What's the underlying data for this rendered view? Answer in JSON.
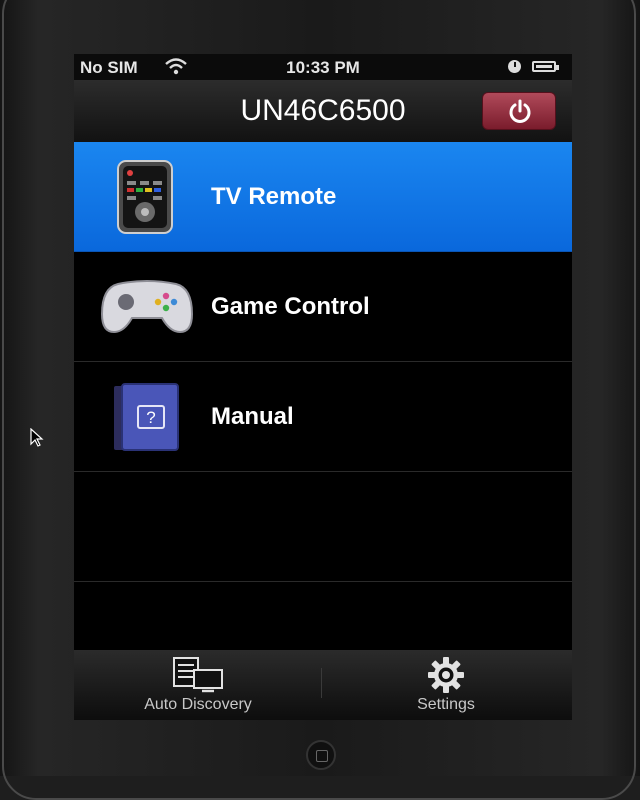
{
  "statusbar": {
    "carrier": "No SIM",
    "time": "10:33 PM"
  },
  "navbar": {
    "title": "UN46C6500",
    "power_icon": "power-icon"
  },
  "menu": {
    "items": [
      {
        "label": "TV Remote",
        "icon": "tv-remote-icon",
        "selected": true
      },
      {
        "label": "Game Control",
        "icon": "gamepad-icon",
        "selected": false
      },
      {
        "label": "Manual",
        "icon": "manual-book-icon",
        "selected": false
      }
    ]
  },
  "tabbar": {
    "tabs": [
      {
        "label": "Auto Discovery",
        "icon": "auto-discovery-icon"
      },
      {
        "label": "Settings",
        "icon": "gear-icon"
      }
    ]
  },
  "colors": {
    "selected_row": "#1478e8",
    "power_button": "#9a2e40"
  }
}
